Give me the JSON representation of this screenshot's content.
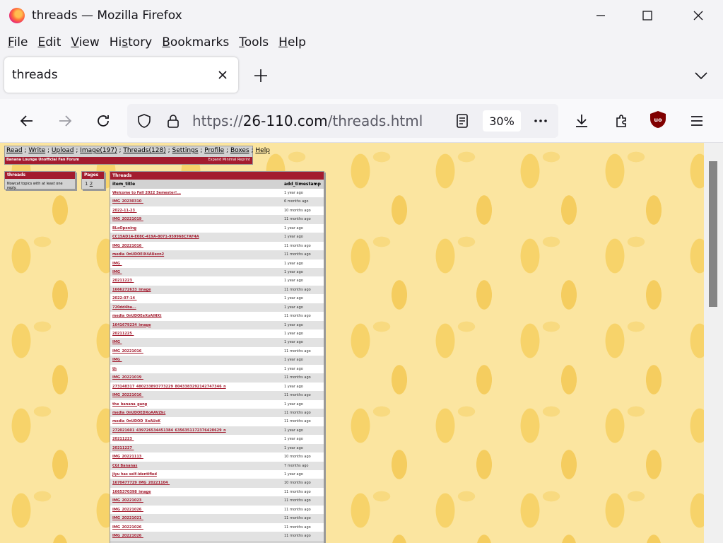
{
  "window": {
    "title": "threads — Mozilla Firefox"
  },
  "menubar": {
    "items": [
      {
        "key": "F",
        "rest": "ile"
      },
      {
        "key": "E",
        "rest": "dit"
      },
      {
        "key": "V",
        "rest": "iew"
      },
      {
        "key": "s",
        "pre": "Hi",
        "rest": "tory"
      },
      {
        "key": "B",
        "rest": "ookmarks"
      },
      {
        "key": "T",
        "rest": "ools"
      },
      {
        "key": "H",
        "rest": "elp"
      }
    ]
  },
  "tab": {
    "label": "threads"
  },
  "navbar": {
    "url_scheme": "https://",
    "url_host": "26-110.com",
    "url_path": "/threads.html",
    "zoom": "30%"
  },
  "page": {
    "topnav": [
      "Read",
      "Write",
      "Upload",
      "Image(197)",
      "Threads(128)",
      "Settings",
      "Profile",
      "Boxes",
      "Help"
    ],
    "forum_name": "Banana Lounge Unofficial Fan Forum",
    "view_options": "Expand  Minimal  Reprint",
    "threads_panel": {
      "title": "threads",
      "body": "Nowcat topics with at least one reply."
    },
    "pages_panel": {
      "title": "Pages",
      "pages": [
        "1",
        "2"
      ]
    },
    "threads_table": {
      "title": "Threads",
      "col_title": "item_title",
      "col_time": "add_timestamp",
      "rows": [
        {
          "title": "Welcome to Fall 2022 Semester!...",
          "ago": "1 year ago"
        },
        {
          "title": "IMG_20230310_",
          "ago": "6 months ago"
        },
        {
          "title": "2022-11-23_",
          "ago": "10 months ago"
        },
        {
          "title": "IMG_20221019_",
          "ago": "11 months ago"
        },
        {
          "title": "BLoOpening",
          "ago": "1 year ago"
        },
        {
          "title": "CC15AD14-E08C-419A-8071-959968C7AF4A",
          "ago": "1 year ago"
        },
        {
          "title": "IMG_20221016_",
          "ago": "11 months ago"
        },
        {
          "title": "media_0nUDOEiX4AUexn2",
          "ago": "11 months ago"
        },
        {
          "title": "IMG_",
          "ago": "1 year ago"
        },
        {
          "title": "IMG_",
          "ago": "1 year ago"
        },
        {
          "title": "20211223_",
          "ago": "1 year ago"
        },
        {
          "title": "1666272633_image",
          "ago": "11 months ago"
        },
        {
          "title": "2022-07-14_",
          "ago": "1 year ago"
        },
        {
          "title": "720dd4ba...",
          "ago": "1 year ago"
        },
        {
          "title": "media_0nUDOEeXoAINXt",
          "ago": "11 months ago"
        },
        {
          "title": "1641679234_image",
          "ago": "1 year ago"
        },
        {
          "title": "20211225_",
          "ago": "1 year ago"
        },
        {
          "title": "IMG_",
          "ago": "1 year ago"
        },
        {
          "title": "IMG_20221016_",
          "ago": "11 months ago"
        },
        {
          "title": "IMG_",
          "ago": "1 year ago"
        },
        {
          "title": "th",
          "ago": "1 year ago"
        },
        {
          "title": "IMG_20221019_",
          "ago": "11 months ago"
        },
        {
          "title": "273148317_480233893773229_8043383292142747346_n",
          "ago": "1 year ago"
        },
        {
          "title": "IMG_20221016_",
          "ago": "11 months ago"
        },
        {
          "title": "the_banana_gang",
          "ago": "1 year ago"
        },
        {
          "title": "media_0nUDOEDXoAAVZkc",
          "ago": "11 months ago"
        },
        {
          "title": "media_0nUDOD_XoAUxK",
          "ago": "11 months ago"
        },
        {
          "title": "272021601_439726534451384_6356351172376420629_n",
          "ago": "1 year ago"
        },
        {
          "title": "20211223_",
          "ago": "1 year ago"
        },
        {
          "title": "20211227_",
          "ago": "1 year ago"
        },
        {
          "title": "IMG_20221113_",
          "ago": "10 months ago"
        },
        {
          "title": "CGI Bananas",
          "ago": "7 months ago"
        },
        {
          "title": "jiyu has self-identified",
          "ago": "1 year ago"
        },
        {
          "title": "1670477729_IMG_20221104_",
          "ago": "10 months ago"
        },
        {
          "title": "1665370398_image",
          "ago": "11 months ago"
        },
        {
          "title": "IMG_20221023_",
          "ago": "11 months ago"
        },
        {
          "title": "IMG_20221026_",
          "ago": "11 months ago"
        },
        {
          "title": "IMG_20221021_",
          "ago": "11 months ago"
        },
        {
          "title": "IMG_20221026_",
          "ago": "11 months ago"
        },
        {
          "title": "IMG_20221026_",
          "ago": "11 months ago"
        }
      ]
    }
  }
}
